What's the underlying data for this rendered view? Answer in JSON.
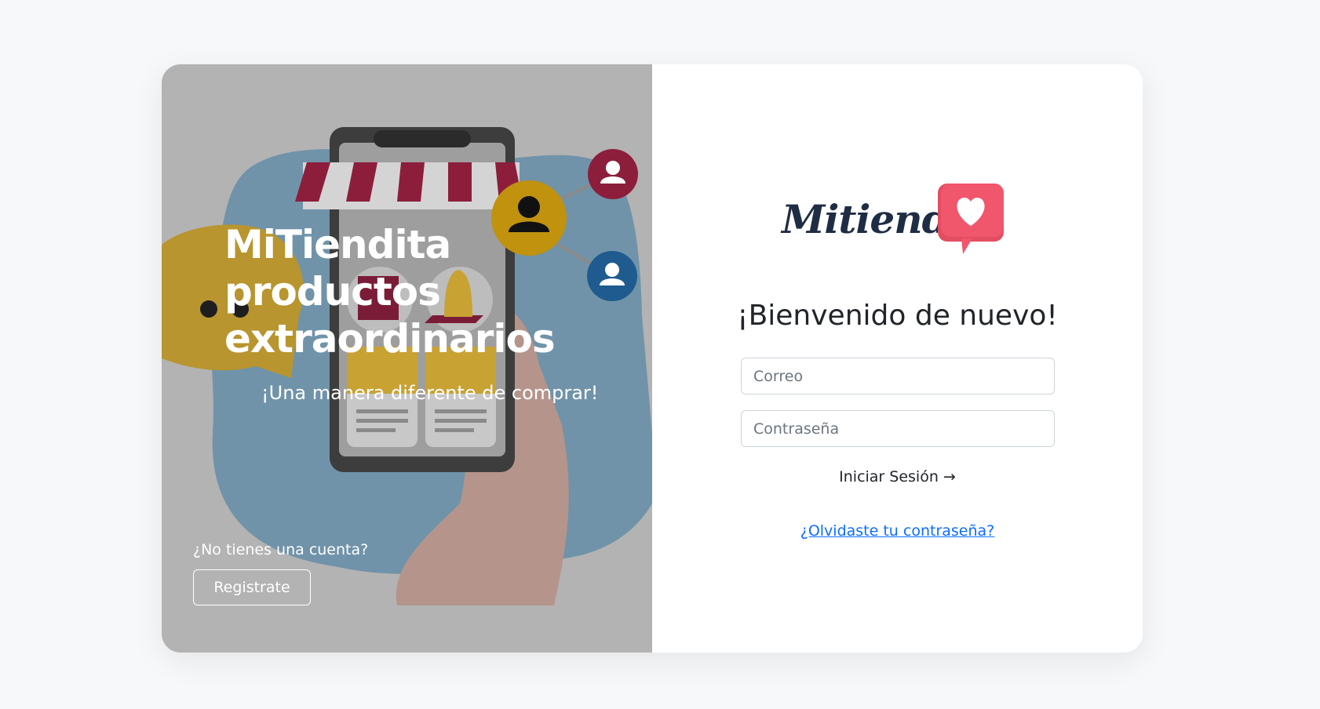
{
  "hero": {
    "headline_line1": "MiTiendita",
    "headline_line2": "productos",
    "headline_line3": "extraordinarios",
    "tagline": "¡Una manera diferente de comprar!",
    "no_account": "¿No tienes una cuenta?",
    "register_label": "Registrate"
  },
  "brand": {
    "logo_text": "Mitiendita",
    "logo_icon": "heart-chat-bubble-icon",
    "accent": "#f0566c",
    "text_color": "#1f2d44"
  },
  "login": {
    "welcome": "¡Bienvenido de nuevo!",
    "email_placeholder": "Correo",
    "password_placeholder": "Contraseña",
    "submit_label": "Iniciar Sesión →",
    "forgot_label": "¿Olvidaste tu contraseña?"
  },
  "colors": {
    "page_bg": "#f7f8fa",
    "link": "#0d6efd",
    "overlay": "#b3b3b3"
  }
}
